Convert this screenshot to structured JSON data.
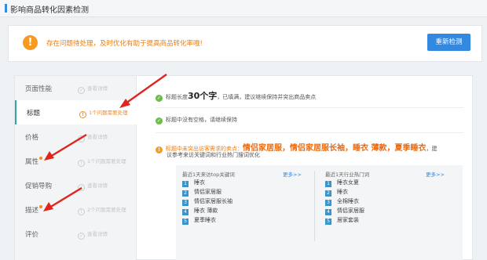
{
  "header": {
    "title": "影响商品转化因素检测"
  },
  "alert": {
    "icon": "warning-icon",
    "text": "存在问题待处理，及时优化有助于提高商品转化率哦!",
    "button": "重新检测"
  },
  "sidebar": {
    "items": [
      {
        "label": "页面性能",
        "status": "查看详情",
        "status_icon": "check-circle-icon",
        "dot": false,
        "active": false
      },
      {
        "label": "标题",
        "status": "1个问题需要处理",
        "status_icon": "warning-circle-icon",
        "dot": false,
        "active": true
      },
      {
        "label": "价格",
        "status": "查看详情",
        "status_icon": "check-circle-icon",
        "dot": false,
        "active": false
      },
      {
        "label": "属性",
        "status": "1个问题需要处理",
        "status_icon": "warning-circle-icon",
        "dot": true,
        "active": false
      },
      {
        "label": "促销导购",
        "status": "查看详情",
        "status_icon": "check-circle-icon",
        "dot": false,
        "active": false
      },
      {
        "label": "描述",
        "status": "2个问题需要处理",
        "status_icon": "warning-circle-icon",
        "dot": true,
        "active": false
      },
      {
        "label": "评价",
        "status": "查看详情",
        "status_icon": "check-circle-icon",
        "dot": false,
        "active": false
      }
    ]
  },
  "checks": {
    "length": {
      "pre": "标题长度",
      "value": "30个字",
      "post": "，已填满，建议继续保持并突出商品卖点"
    },
    "spaces": {
      "text": "标题中没有空格，请继续保持"
    },
    "keywords": {
      "pre": "标题中未突出访客需求的卖点：",
      "words": "情侣家居服，情侣家居服长袖，睡衣 薄款，夏季睡衣",
      "post": "，建",
      "note": "议参考来访关键词和行业热门搜词优化"
    }
  },
  "keyword_box": {
    "left": {
      "title": "最近1天来访top关键词",
      "more": "更多>>",
      "items": [
        "睡衣",
        "情侣家居服",
        "情侣家居服长袖",
        "睡衣 薄款",
        "夏季睡衣"
      ]
    },
    "right": {
      "title": "最近1天行业热门词",
      "more": "更多>>",
      "items": [
        "睡衣女夏",
        "睡衣",
        "全棉睡衣",
        "情侣家居服",
        "居家套装"
      ]
    }
  },
  "colors": {
    "accent_blue": "#3388e0",
    "warning_orange": "#f59a23",
    "ok_green": "#6cbc4a",
    "arrow_red": "#e0251e"
  }
}
